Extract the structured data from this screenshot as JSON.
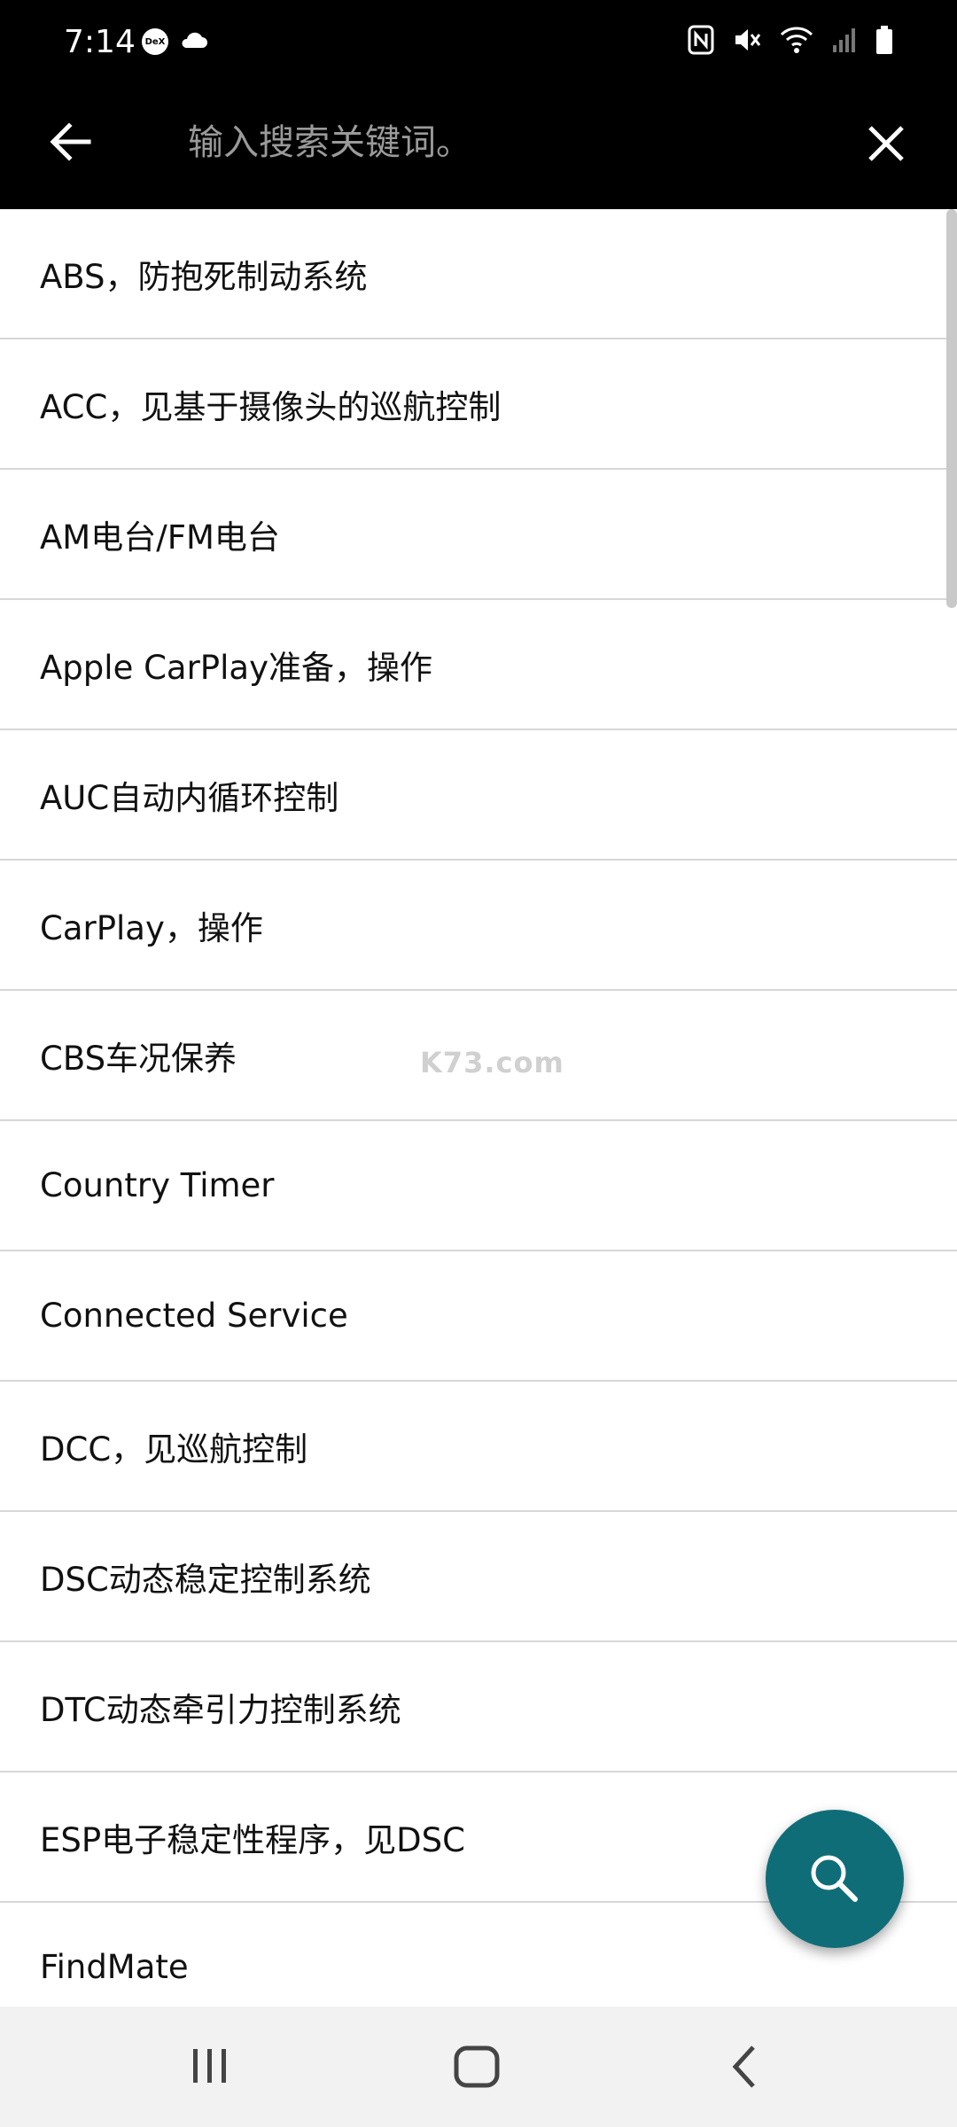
{
  "status_bar": {
    "time": "7:14",
    "dex_label": "DeX",
    "icons": [
      "dex-icon",
      "cloud-icon",
      "nfc-icon",
      "mute-icon",
      "wifi-icon",
      "signal-icon",
      "battery-icon"
    ]
  },
  "app_bar": {
    "search_placeholder": "输入搜索关键词。",
    "back_icon": "arrow-left-icon",
    "close_icon": "close-icon"
  },
  "list": {
    "items": [
      {
        "label": "ABS，防抱死制动系统"
      },
      {
        "label": "ACC，见基于摄像头的巡航控制"
      },
      {
        "label": "AM电台/FM电台"
      },
      {
        "label": "Apple CarPlay准备，操作"
      },
      {
        "label": "AUC自动内循环控制"
      },
      {
        "label": "CarPlay，操作"
      },
      {
        "label": "CBS车况保养"
      },
      {
        "label": "Country Timer"
      },
      {
        "label": "Connected Service"
      },
      {
        "label": "DCC，见巡航控制"
      },
      {
        "label": "DSC动态稳定控制系统"
      },
      {
        "label": "DTC动态牵引力控制系统"
      },
      {
        "label": "ESP电子稳定性程序，见DSC"
      },
      {
        "label": "FindMate"
      }
    ]
  },
  "watermark": "K73.com",
  "fab": {
    "icon": "search-icon",
    "color": "#0f6d78"
  },
  "nav_bar": {
    "icons": [
      "recent-apps-icon",
      "home-icon",
      "back-icon"
    ]
  }
}
